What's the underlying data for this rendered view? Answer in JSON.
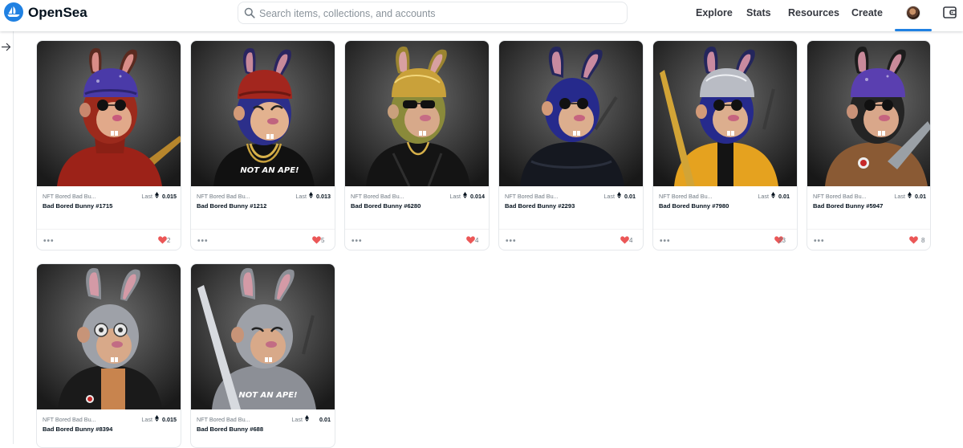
{
  "header": {
    "brand": "OpenSea",
    "search_placeholder": "Search items, collections, and accounts",
    "nav": [
      "Explore",
      "Stats",
      "Resources",
      "Create"
    ]
  },
  "colors": {
    "accent": "#2081e2",
    "heart": "#eb5757"
  },
  "icons": {
    "search": "search-icon",
    "wallet": "wallet-icon",
    "sidebar": "arrow-right-icon",
    "currency": "eth-icon",
    "favorite": "heart-icon",
    "menu": "more-icon"
  },
  "cards": [
    {
      "collection": "NFT Bored Bad Bu...",
      "last_label": "Last",
      "price": "0.015",
      "name": "Bad Bored Bunny #1715",
      "likes": "2",
      "more": "•••"
    },
    {
      "collection": "NFT Bored Bad Bu...",
      "last_label": "Last",
      "price": "0.013",
      "name": "Bad Bored Bunny #1212",
      "likes": "5",
      "more": "•••"
    },
    {
      "collection": "NFT Bored Bad Bu...",
      "last_label": "Last",
      "price": "0.014",
      "name": "Bad Bored Bunny #6280",
      "likes": "4",
      "more": "•••"
    },
    {
      "collection": "NFT Bored Bad Bu...",
      "last_label": "Last",
      "price": "0.01",
      "name": "Bad Bored Bunny #2293",
      "likes": "4",
      "more": "•••"
    },
    {
      "collection": "NFT Bored Bad Bu...",
      "last_label": "Last",
      "price": "0.01",
      "name": "Bad Bored Bunny #7980",
      "likes": "23",
      "more": "•••"
    },
    {
      "collection": "NFT Bored Bad Bu...",
      "last_label": "Last",
      "price": "0.01",
      "name": "Bad Bored Bunny #5947",
      "likes": "8",
      "more": "•••"
    },
    {
      "collection": "NFT Bored Bad Bu...",
      "last_label": "Last",
      "price": "0.015",
      "name": "Bad Bored Bunny #8394",
      "likes": "",
      "more": ""
    },
    {
      "collection": "NFT Bored Bad Bu...",
      "last_label": "Last",
      "price": "0.01",
      "name": "Bad Bored Bunny #688",
      "likes": "",
      "more": ""
    }
  ]
}
